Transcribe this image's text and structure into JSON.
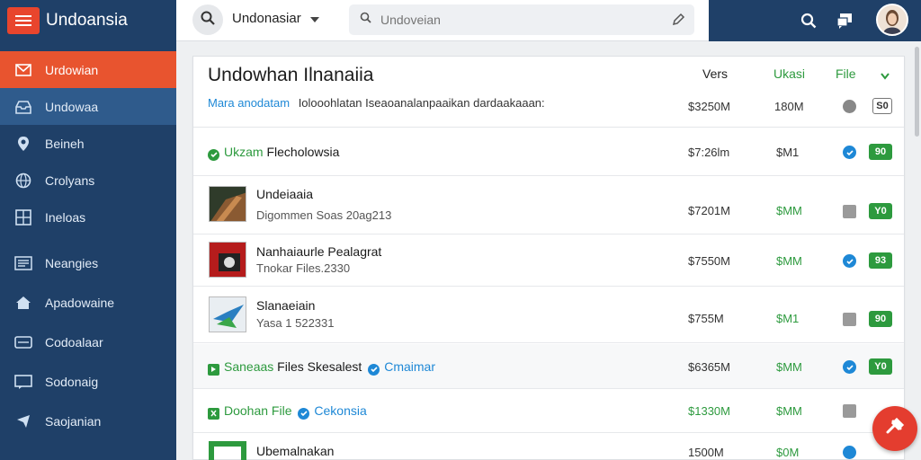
{
  "app": {
    "title": "Undoansia"
  },
  "sidebar": {
    "items": [
      {
        "label": "Urdowian",
        "icon": "mail-icon"
      },
      {
        "label": "Undowaa",
        "icon": "inbox-icon"
      },
      {
        "label": "Beineh",
        "icon": "pin-icon"
      },
      {
        "label": "Crolyans",
        "icon": "globe-icon"
      },
      {
        "label": "Ineloas",
        "icon": "grid-icon"
      },
      {
        "label": "Neangies",
        "icon": "list-icon"
      },
      {
        "label": "Apadowaine",
        "icon": "home-icon"
      },
      {
        "label": "Codoalaar",
        "icon": "card-icon"
      },
      {
        "label": "Sodonaig",
        "icon": "message-icon"
      },
      {
        "label": "Saojanian",
        "icon": "export-icon"
      }
    ]
  },
  "topbar": {
    "selected_region": "Undonasiar",
    "search_placeholder": "Undoveian"
  },
  "panel": {
    "title": "Undowhan Ilnanaiia",
    "link_text": "Mara anodatam",
    "subtitle": "Iolooohlatan Iseaoanalanpaaikan dardaakaaan:",
    "columns": {
      "price": "Vers",
      "qty": "Ukasi",
      "file": "File"
    },
    "header_price": "$3250M",
    "header_qty": "180M",
    "header_badge": "S0"
  },
  "rows": [
    {
      "name": "Ukzam",
      "name2": "Flecholowsia",
      "price": "$7:26lm",
      "qty": "$M1",
      "badge": "90",
      "status": "check"
    },
    {
      "name": "Undeiaaia",
      "meta": "Digommen Soas 20ag213",
      "price": "$7201M",
      "qty": "$MM",
      "badge": "Y0",
      "status": "trash"
    },
    {
      "name": "Nanhaiaurle Pealagrat",
      "meta": "Tnokar Files.2330",
      "price": "$7550M",
      "qty": "$MM",
      "badge": "93",
      "status": "check"
    },
    {
      "name": "Slanaeiain",
      "meta": "Yasa 1 522331",
      "price": "$755M",
      "qty": "$M1",
      "badge": "90",
      "status": "trash"
    },
    {
      "name": "Saneaas",
      "name2": "Files Skesalest",
      "name3": "Cmaimar",
      "price": "$6365M",
      "qty": "$MM",
      "badge": "Y0",
      "status": "check"
    },
    {
      "name": "Doohan File",
      "name2": "Cekonsia",
      "price": "$1330M",
      "qty": "$MM",
      "badge": "",
      "status": "trash"
    },
    {
      "name": "Ubemalnakan",
      "price": "1500M",
      "qty": "$0M",
      "badge": "",
      "status": "check"
    }
  ],
  "colors": {
    "accent": "#e8542f",
    "sidebar": "#1f4068",
    "green": "#2d9a3e",
    "blue": "#1e88d6"
  }
}
